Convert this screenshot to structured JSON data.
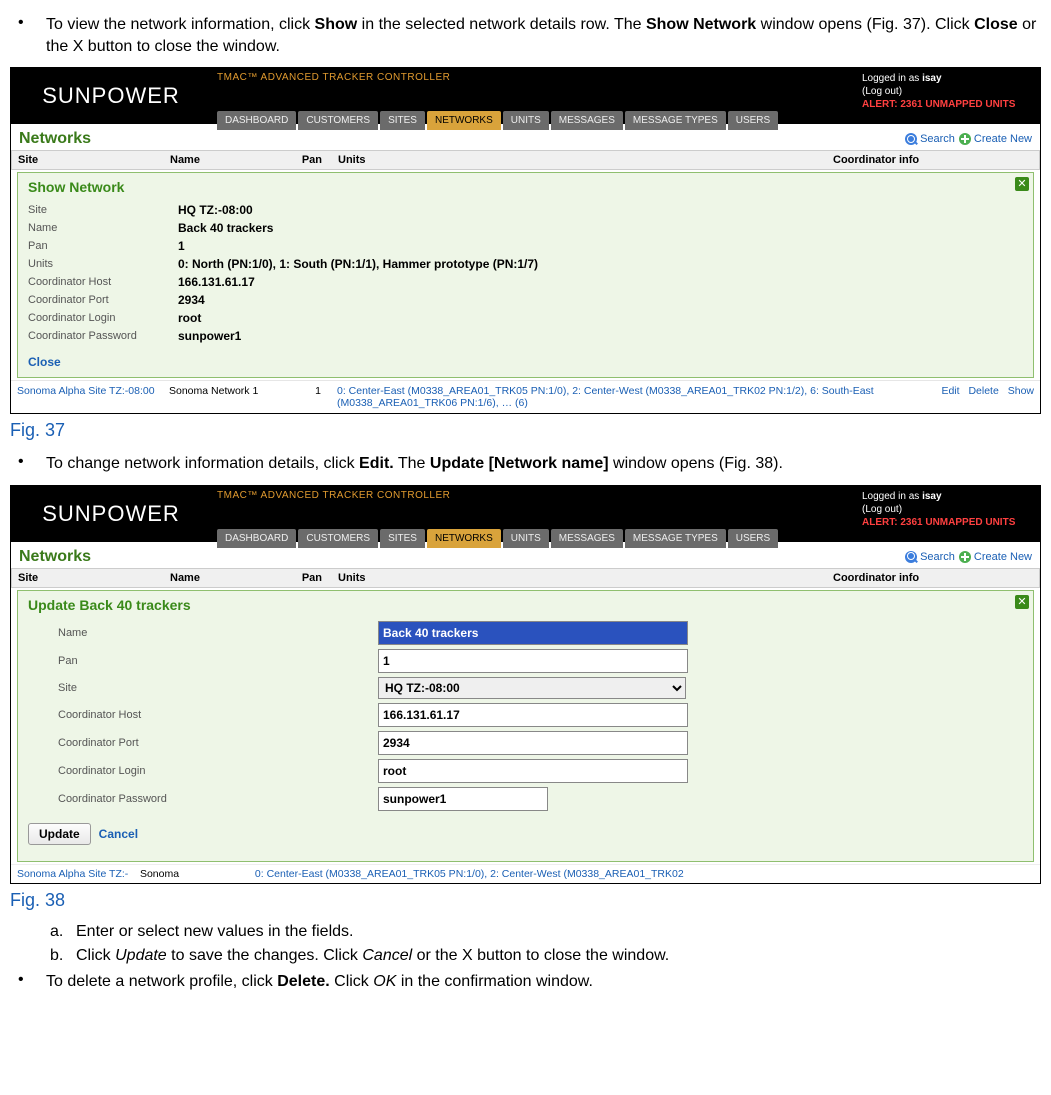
{
  "doc": {
    "bullet1_a": "To view the network information, click ",
    "bullet1_b": "Show",
    "bullet1_c": " in the selected network details row. The ",
    "bullet1_d": "Show Network",
    "bullet1_e": " window opens (Fig. 37). Click ",
    "bullet1_f": "Close",
    "bullet1_g": " or the X button to close the window.",
    "fig37": "Fig. 37",
    "bullet2_a": "To change network information details, click ",
    "bullet2_b": "Edit.",
    "bullet2_c": " The ",
    "bullet2_d": "Update [Network name]",
    "bullet2_e": " window opens (Fig. 38).",
    "fig38": "Fig. 38",
    "sub_a": "Enter or select new values in the fields.",
    "sub_b_1": "Click ",
    "sub_b_2": "Update",
    "sub_b_3": " to save the changes. Click ",
    "sub_b_4": "Cancel",
    "sub_b_5": " or the X button to close the window.",
    "bullet3_a": "To delete a network profile, click ",
    "bullet3_b": "Delete.",
    "bullet3_c": " Click ",
    "bullet3_d": "OK",
    "bullet3_e": " in the confirmation window."
  },
  "app": {
    "logo": "SUNPOWER",
    "brand": "TMAC™ ADVANCED TRACKER CONTROLLER",
    "tabs": [
      "DASHBOARD",
      "CUSTOMERS",
      "SITES",
      "NETWORKS",
      "UNITS",
      "MESSAGES",
      "MESSAGE TYPES",
      "USERS"
    ],
    "active_tab": "NETWORKS",
    "user_line": "Logged in as ",
    "user_name": "isay",
    "logout": "(Log out)",
    "alert": "ALERT: 2361 UNMAPPED UNITS",
    "page_title": "Networks",
    "search": "Search",
    "create_new": "Create New",
    "cols": {
      "site": "Site",
      "name": "Name",
      "pan": "Pan",
      "units": "Units",
      "coord": "Coordinator info"
    }
  },
  "show": {
    "title": "Show Network",
    "rows": {
      "site_k": "Site",
      "site_v": "HQ TZ:-08:00",
      "name_k": "Name",
      "name_v": "Back 40 trackers",
      "pan_k": "Pan",
      "pan_v": "1",
      "units_k": "Units",
      "units_v": "0: North (PN:1/0), 1: South (PN:1/1), Hammer prototype (PN:1/7)",
      "host_k": "Coordinator Host",
      "host_v": "166.131.61.17",
      "port_k": "Coordinator Port",
      "port_v": "2934",
      "login_k": "Coordinator Login",
      "login_v": "root",
      "pass_k": "Coordinator Password",
      "pass_v": "sunpower1"
    },
    "close": "Close"
  },
  "listrow": {
    "site": "Sonoma Alpha Site TZ:-08:00",
    "name": "Sonoma Network 1",
    "pan": "1",
    "units": "0: Center-East (M0338_AREA01_TRK05 PN:1/0), 2: Center-West (M0338_AREA01_TRK02 PN:1/2), 6: South-East (M0338_AREA01_TRK06 PN:1/6), … (6)",
    "edit": "Edit",
    "delete": "Delete",
    "show": "Show"
  },
  "update": {
    "title": "Update Back 40 trackers",
    "labels": {
      "name": "Name",
      "pan": "Pan",
      "site": "Site",
      "host": "Coordinator Host",
      "port": "Coordinator Port",
      "login": "Coordinator Login",
      "pass": "Coordinator Password"
    },
    "values": {
      "name": "Back 40 trackers",
      "pan": "1",
      "site": "HQ TZ:-08:00",
      "host": "166.131.61.17",
      "port": "2934",
      "login": "root",
      "pass": "sunpower1"
    },
    "btn": "Update",
    "cancel": "Cancel"
  },
  "trunc": {
    "site": "Sonoma Alpha Site TZ:-",
    "name": "Sonoma",
    "units": "0: Center-East (M0338_AREA01_TRK05 PN:1/0), 2: Center-West (M0338_AREA01_TRK02"
  }
}
